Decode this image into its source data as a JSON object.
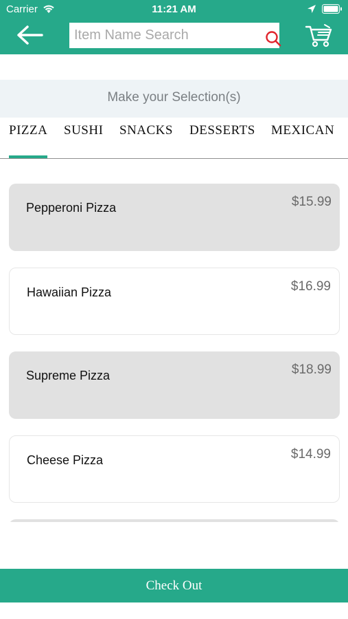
{
  "status_bar": {
    "carrier": "Carrier",
    "time": "11:21 AM"
  },
  "nav": {
    "search_placeholder": "Item Name Search",
    "search_value": ""
  },
  "subheader": "Make your Selection(s)",
  "tabs": [
    {
      "label": "PIZZA",
      "selected": true
    },
    {
      "label": "SUSHI",
      "selected": false
    },
    {
      "label": "SNACKS",
      "selected": false
    },
    {
      "label": "DESSERTS",
      "selected": false
    },
    {
      "label": "MEXICAN",
      "selected": false
    }
  ],
  "items": [
    {
      "name": "Pepperoni Pizza",
      "price": "$15.99"
    },
    {
      "name": "Hawaiian Pizza",
      "price": "$16.99"
    },
    {
      "name": "Supreme Pizza",
      "price": "$18.99"
    },
    {
      "name": "Cheese Pizza",
      "price": "$14.99"
    }
  ],
  "checkout_label": "Check Out",
  "colors": {
    "accent": "#26a98a",
    "search_icon": "#e0232b"
  }
}
